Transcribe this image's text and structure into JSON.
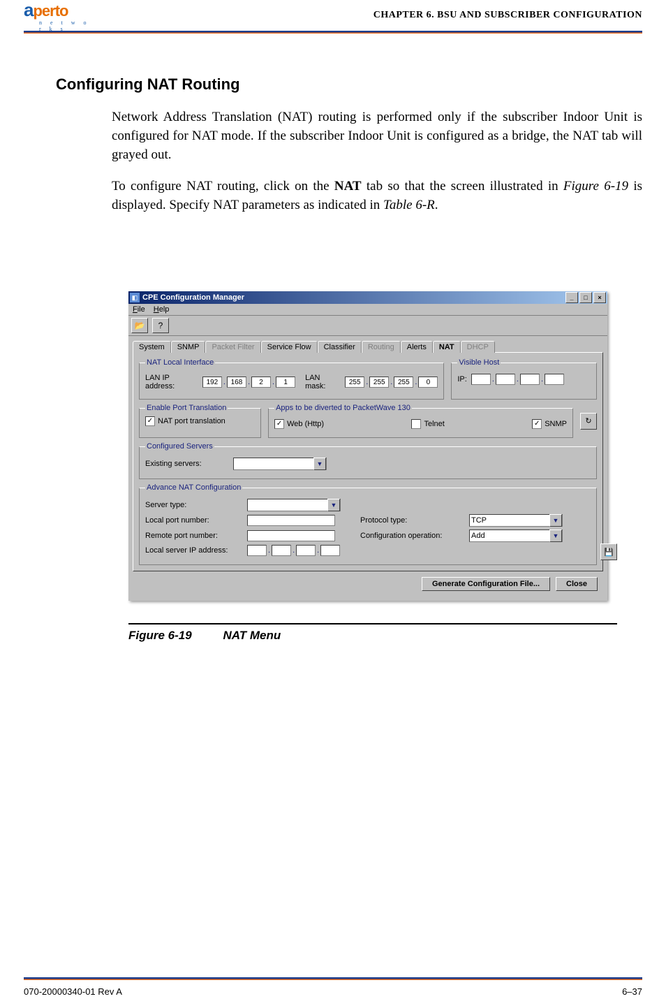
{
  "header": {
    "logo_main": "aperto",
    "logo_sub": "n e t w o r k s",
    "chapter": "CHAPTER 6.   BSU AND SUBSCRIBER CONFIGURATION"
  },
  "section": {
    "title": "Configuring NAT Routing",
    "para1": "Network Address Translation (NAT) routing is performed only if the subscriber Indoor Unit is configured for NAT mode. If the subscriber Indoor Unit is configured as a bridge, the NAT tab will grayed out.",
    "para2_pre": "To configure NAT routing, click on the ",
    "para2_bold": "NAT",
    "para2_mid": " tab so that the screen illustrated in ",
    "para2_fig": "Figure 6-19",
    "para2_mid2": " is displayed. Specify NAT parameters as indicated in ",
    "para2_tbl": "Table 6-R",
    "para2_end": "."
  },
  "window": {
    "title": "CPE Configuration Manager",
    "menus": [
      "File",
      "Help"
    ],
    "tabs": {
      "items": [
        {
          "label": "System",
          "state": "normal"
        },
        {
          "label": "SNMP",
          "state": "normal"
        },
        {
          "label": "Packet Filter",
          "state": "disabled"
        },
        {
          "label": "Service Flow",
          "state": "normal"
        },
        {
          "label": "Classifier",
          "state": "normal"
        },
        {
          "label": "Routing",
          "state": "disabled"
        },
        {
          "label": "Alerts",
          "state": "normal"
        },
        {
          "label": "NAT",
          "state": "active"
        },
        {
          "label": "DHCP",
          "state": "disabled"
        }
      ]
    },
    "groups": {
      "nat_local": {
        "legend": "NAT Local Interface",
        "lan_ip_label": "LAN IP address:",
        "lan_ip": [
          "192",
          "168",
          "2",
          "1"
        ],
        "lan_mask_label": "LAN mask:",
        "lan_mask": [
          "255",
          "255",
          "255",
          "0"
        ]
      },
      "visible_host": {
        "legend": "Visible Host",
        "ip_label": "IP:",
        "ip": [
          "",
          "",
          "",
          ""
        ]
      },
      "enable_port": {
        "legend": "Enable Port Translation",
        "chk_label": "NAT port translation",
        "chk_checked": true
      },
      "apps_divert": {
        "legend": "Apps to be diverted to PacketWave 130",
        "web": {
          "label": "Web (Http)",
          "checked": true
        },
        "telnet": {
          "label": "Telnet",
          "checked": false
        },
        "snmp": {
          "label": "SNMP",
          "checked": true
        }
      },
      "configured_servers": {
        "legend": "Configured Servers",
        "existing_label": "Existing servers:",
        "existing_value": ""
      },
      "adv_nat": {
        "legend": "Advance NAT Configuration",
        "server_type_label": "Server type:",
        "server_type_value": "",
        "local_port_label": "Local port number:",
        "local_port_value": "",
        "remote_port_label": "Remote port number:",
        "remote_port_value": "",
        "local_server_ip_label": "Local server IP address:",
        "local_server_ip": [
          "",
          "",
          "",
          ""
        ],
        "protocol_type_label": "Protocol type:",
        "protocol_type_value": "TCP",
        "config_op_label": "Configuration operation:",
        "config_op_value": "Add"
      }
    },
    "buttons": {
      "generate": "Generate Configuration File...",
      "close": "Close"
    }
  },
  "figure": {
    "num": "Figure 6-19",
    "caption": "NAT Menu"
  },
  "footer": {
    "left": "070-20000340-01 Rev A",
    "right": "6–37"
  }
}
